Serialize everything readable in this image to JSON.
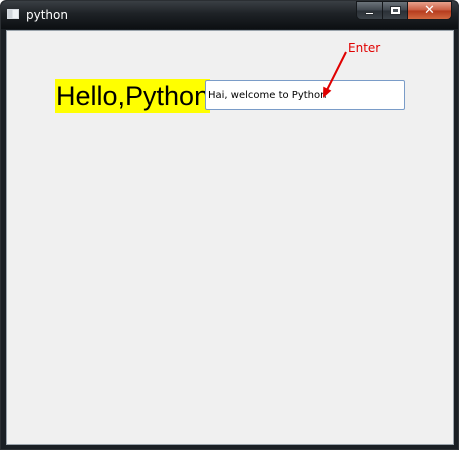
{
  "window": {
    "title": "python",
    "close_glyph": "✕"
  },
  "label": {
    "text": "Hello,Python",
    "background": "#ffff00"
  },
  "entry": {
    "value": "Hai, welcome to Python"
  },
  "annotation": {
    "text": "Enter",
    "color": "#e00000"
  },
  "icons": {
    "app": "app-window-icon",
    "minimize": "minimize-icon",
    "maximize": "maximize-icon",
    "close": "close-icon",
    "arrow": "arrow-icon"
  }
}
